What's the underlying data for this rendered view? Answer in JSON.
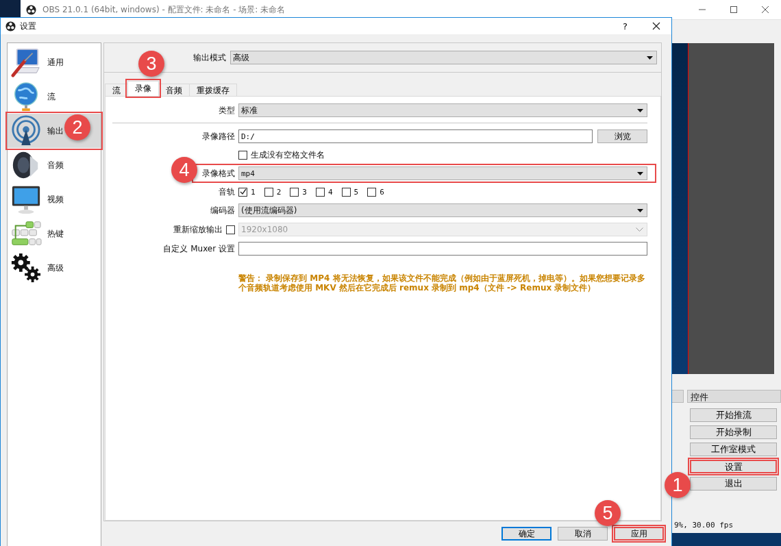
{
  "main_window": {
    "title": "OBS 21.0.1 (64bit, windows) - 配置文件: 未命名 - 场景: 未命名",
    "controls_dock": {
      "title": "控件",
      "buttons": [
        {
          "label": "开始推流",
          "highlighted": false
        },
        {
          "label": "开始录制",
          "highlighted": false
        },
        {
          "label": "工作室模式",
          "highlighted": false
        },
        {
          "label": "设置",
          "highlighted": true
        },
        {
          "label": "退出",
          "highlighted": false
        }
      ]
    },
    "status_bar": {
      "stats": "9%, 30.00 fps"
    }
  },
  "dialog": {
    "title": "设置",
    "help": "?",
    "sidebar": {
      "items": [
        {
          "label": "通用",
          "kind": "general",
          "selected": false,
          "highlighted": false
        },
        {
          "label": "流",
          "kind": "stream",
          "selected": false,
          "highlighted": false
        },
        {
          "label": "输出",
          "kind": "output",
          "selected": true,
          "highlighted": true
        },
        {
          "label": "音频",
          "kind": "audio",
          "selected": false,
          "highlighted": false
        },
        {
          "label": "视频",
          "kind": "video",
          "selected": false,
          "highlighted": false
        },
        {
          "label": "热键",
          "kind": "hotkeys",
          "selected": false,
          "highlighted": false
        },
        {
          "label": "高级",
          "kind": "advanced",
          "selected": false,
          "highlighted": false
        }
      ]
    },
    "output_mode": {
      "label": "输出模式",
      "value": "高级"
    },
    "tabs": [
      {
        "label": "流",
        "selected": false,
        "highlighted": false
      },
      {
        "label": "录像",
        "selected": true,
        "highlighted": true
      },
      {
        "label": "音频",
        "selected": false,
        "highlighted": false
      },
      {
        "label": "重拨缓存",
        "selected": false,
        "highlighted": false
      }
    ],
    "form": {
      "type": {
        "label": "类型",
        "value": "标准"
      },
      "path": {
        "label": "录像路径",
        "value": "D:/",
        "button": "浏览"
      },
      "no_space_filenames": {
        "label": "生成没有空格文件名",
        "checked": false
      },
      "format": {
        "label": "录像格式",
        "value": "mp4",
        "highlighted": true
      },
      "tracks": {
        "label": "音轨",
        "items": [
          {
            "label": "1",
            "checked": true
          },
          {
            "label": "2",
            "checked": false
          },
          {
            "label": "3",
            "checked": false
          },
          {
            "label": "4",
            "checked": false
          },
          {
            "label": "5",
            "checked": false
          },
          {
            "label": "6",
            "checked": false
          }
        ]
      },
      "encoder": {
        "label": "编码器",
        "value": "(使用流编码器)"
      },
      "rescale": {
        "label": "重新缩放输出",
        "checked": false,
        "value": "1920x1080",
        "disabled": true
      },
      "muxer": {
        "label": "自定义 Muxer 设置"
      },
      "warning": "警告： 录制保存到 MP4 将无法恢复，如果该文件不能完成（例如由于蓝屏死机，掉电等）。如果您想要记录多个音频轨道考虑使用 MKV 然后在它完成后 remux 录制到 mp4（文件 -> Remux 录制文件）"
    },
    "buttons": [
      {
        "label": "确定",
        "default": true,
        "highlighted": false
      },
      {
        "label": "取消",
        "default": false,
        "highlighted": false
      },
      {
        "label": "应用",
        "default": false,
        "highlighted": true
      }
    ]
  },
  "annotations": [
    {
      "number": "1"
    },
    {
      "number": "2"
    },
    {
      "number": "3"
    },
    {
      "number": "4"
    },
    {
      "number": "5"
    }
  ]
}
